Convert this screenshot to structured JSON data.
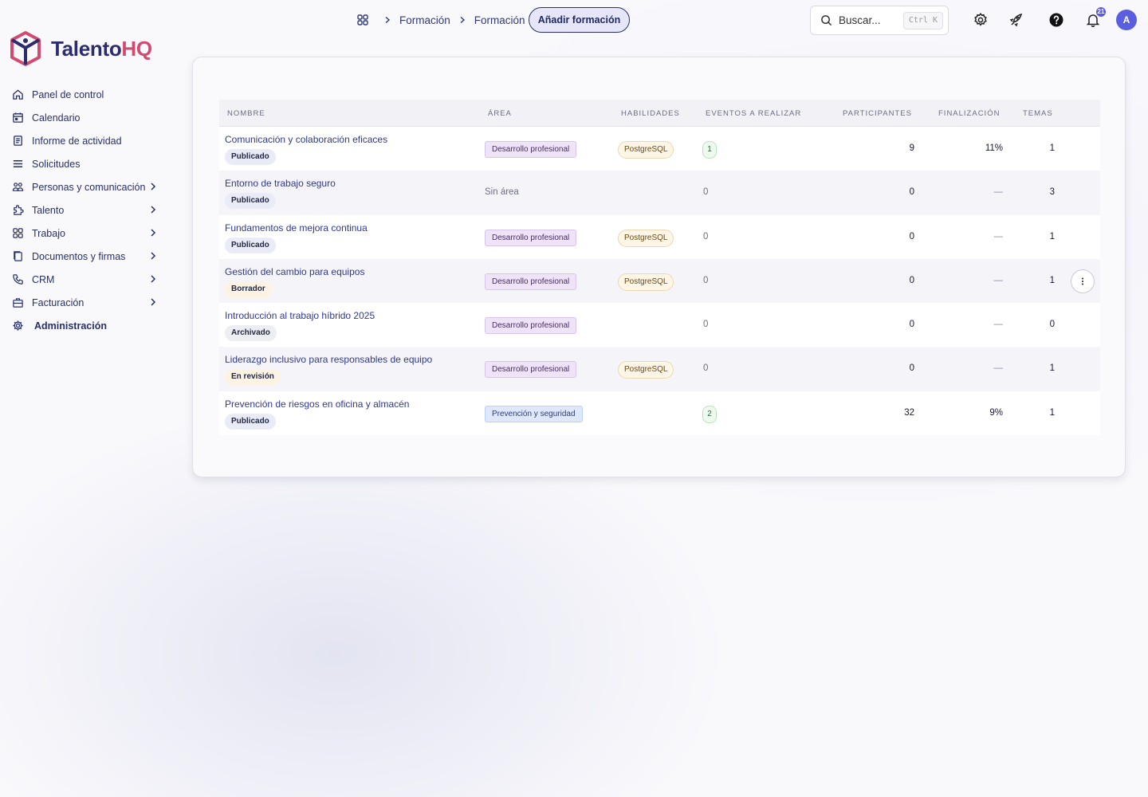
{
  "brand": {
    "name_part1": "Talento",
    "name_part2": "HQ",
    "accent": "#d24a6f",
    "primary": "#2b2d6e"
  },
  "sidebar": {
    "items": [
      {
        "label": "Panel de control",
        "icon": "home-icon"
      },
      {
        "label": "Calendario",
        "icon": "calendar-icon"
      },
      {
        "label": "Informe de actividad",
        "icon": "report-icon"
      },
      {
        "label": "Solicitudes",
        "icon": "list-icon"
      },
      {
        "label": "Personas y comunicación",
        "icon": "people-icon",
        "expandable": true
      },
      {
        "label": "Talento",
        "icon": "puzzle-icon",
        "expandable": true
      },
      {
        "label": "Trabajo",
        "icon": "grid-icon",
        "expandable": true
      },
      {
        "label": "Documentos y firmas",
        "icon": "documents-icon",
        "expandable": true
      },
      {
        "label": "CRM",
        "icon": "phone-icon",
        "expandable": true
      },
      {
        "label": "Facturación",
        "icon": "briefcase-icon",
        "expandable": true
      },
      {
        "label": "Administración",
        "icon": "gear-icon"
      }
    ]
  },
  "topbar": {
    "breadcrumb": [
      "Formación",
      "Formación"
    ],
    "add_button": "Añadir formación",
    "search": {
      "placeholder": "Buscar...",
      "shortcut": "Ctrl K"
    },
    "notifications_count": "21",
    "avatar_initial": "A"
  },
  "table": {
    "columns": [
      "Nombre",
      "Área",
      "Habilidades",
      "Eventos a realizar",
      "Participantes",
      "Finalización",
      "Temas"
    ],
    "rows": [
      {
        "name": "Comunicación y colaboración eficaces",
        "status": "Publicado",
        "area": "Desarrollo profesional",
        "skill": "PostgreSQL",
        "events": "1",
        "participants": "9",
        "completion": "11%",
        "topics": "1"
      },
      {
        "name": "Entorno de trabajo seguro",
        "status": "Publicado",
        "area": "Sin área",
        "skill": "",
        "events": "0",
        "participants": "0",
        "completion": "—",
        "topics": "3"
      },
      {
        "name": "Fundamentos de mejora continua",
        "status": "Publicado",
        "area": "Desarrollo profesional",
        "skill": "PostgreSQL",
        "events": "0",
        "participants": "0",
        "completion": "—",
        "topics": "1"
      },
      {
        "name": "Gestión del cambio para equipos",
        "status": "Borrador",
        "area": "Desarrollo profesional",
        "skill": "PostgreSQL",
        "events": "0",
        "participants": "0",
        "completion": "—",
        "topics": "1"
      },
      {
        "name": "Introducción al trabajo híbrido 2025",
        "status": "Archivado",
        "area": "Desarrollo profesional",
        "skill": "",
        "events": "0",
        "participants": "0",
        "completion": "—",
        "topics": "0"
      },
      {
        "name": "Liderazgo inclusivo para responsables de equipo",
        "status": "En revisión",
        "area": "Desarrollo profesional",
        "skill": "PostgreSQL",
        "events": "0",
        "participants": "0",
        "completion": "—",
        "topics": "1"
      },
      {
        "name": "Prevención de riesgos en oficina y almacén",
        "status": "Publicado",
        "area": "Prevención y seguridad",
        "skill": "",
        "events": "2",
        "participants": "32",
        "completion": "9%",
        "topics": "1"
      }
    ]
  }
}
